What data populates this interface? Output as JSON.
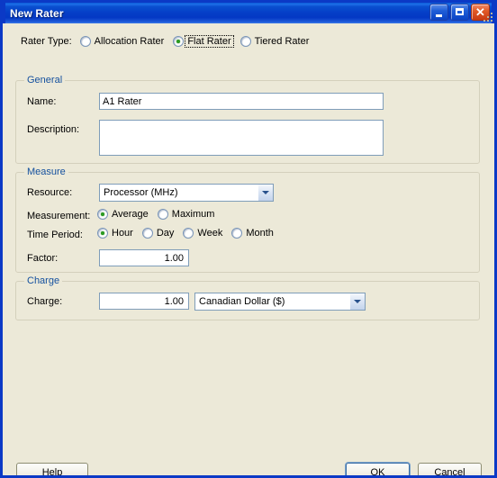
{
  "window": {
    "title": "New Rater",
    "accent_titlebar": "#0540C8",
    "dialog_bg": "#ECE9D8",
    "group_label_color": "#14509E",
    "radio_dot_color": "#2C9B22",
    "buttons": {
      "minimize": "minimize-icon",
      "maximize": "maximize-icon",
      "close": "close-icon",
      "close_glyph": "✕"
    }
  },
  "rater_type": {
    "label": "Rater Type:",
    "options": [
      {
        "label": "Allocation Rater",
        "checked": false,
        "focused": false
      },
      {
        "label": "Flat Rater",
        "checked": true,
        "focused": true
      },
      {
        "label": "Tiered Rater",
        "checked": false,
        "focused": false
      }
    ]
  },
  "general": {
    "title": "General",
    "name_label": "Name:",
    "name_value": "A1 Rater",
    "name_placeholder": "",
    "description_label": "Description:",
    "description_value": "",
    "description_placeholder": ""
  },
  "measure": {
    "title": "Measure",
    "resource_label": "Resource:",
    "resource_value": "Processor (MHz)",
    "resource_options": [
      "Processor (MHz)"
    ],
    "measurement_label": "Measurement:",
    "measurement_options": [
      {
        "label": "Average",
        "checked": true
      },
      {
        "label": "Maximum",
        "checked": false
      }
    ],
    "time_period_label": "Time Period:",
    "time_period_options": [
      {
        "label": "Hour",
        "checked": true
      },
      {
        "label": "Day",
        "checked": false
      },
      {
        "label": "Week",
        "checked": false
      },
      {
        "label": "Month",
        "checked": false
      }
    ],
    "factor_label": "Factor:",
    "factor_value": "1.00"
  },
  "charge": {
    "title": "Charge",
    "charge_label": "Charge:",
    "charge_value": "1.00",
    "currency_value": "Canadian Dollar ($)",
    "currency_options": [
      "Canadian Dollar ($)"
    ]
  },
  "footer": {
    "help_label": "Help",
    "ok_label": "OK",
    "cancel_label": "Cancel"
  }
}
